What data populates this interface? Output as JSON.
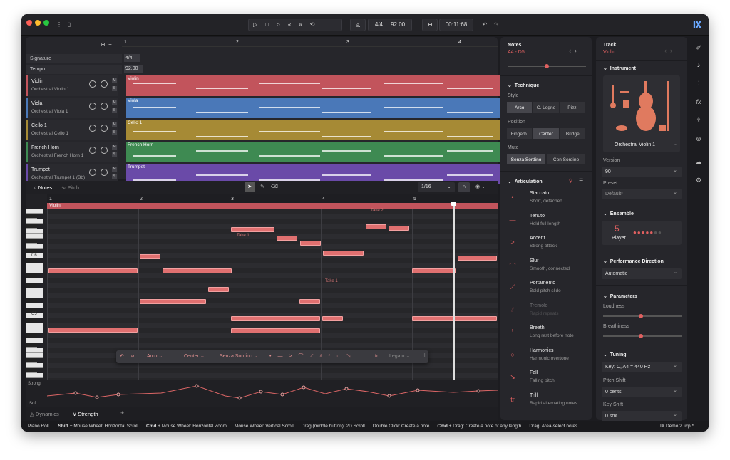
{
  "transport": {
    "signature": "4/4",
    "tempo": "92.00",
    "time": "00:11:68"
  },
  "arrange": {
    "bars": [
      "1",
      "2",
      "3",
      "4"
    ],
    "signature_label": "Signature",
    "signature_value": "4/4",
    "tempo_label": "Tempo",
    "tempo_value": "92.00",
    "tracks": [
      {
        "name": "Violin",
        "sub": "Orchestral Violin 1",
        "lane": "Violin",
        "color": "#c2545c"
      },
      {
        "name": "Viola",
        "sub": "Orchestral Viola 1",
        "lane": "Viola",
        "color": "#4a78b8"
      },
      {
        "name": "Cello 1",
        "sub": "Orchestral Cello 1",
        "lane": "Cello 1",
        "color": "#a68a35"
      },
      {
        "name": "French Horn",
        "sub": "Orchestral French Horn 1",
        "lane": "French Horn",
        "color": "#3e8a52"
      },
      {
        "name": "Trumpet",
        "sub": "Orchestral Trumpet 1 (Bb)",
        "lane": "Trumpet",
        "color": "#6a4aa8"
      }
    ],
    "m": "M",
    "s": "S"
  },
  "editor": {
    "tab_notes": "Notes",
    "tab_pitch": "Pitch",
    "grid": "1/16",
    "bars": [
      "1",
      "2",
      "3",
      "4",
      "5"
    ],
    "region": "Violin",
    "c6": "C6",
    "c5": "C5",
    "takes": [
      "Take 1",
      "Take 1",
      "Take 2"
    ],
    "bottom_tabs": {
      "dynamics": "Dynamics",
      "strength": "Strength"
    },
    "strong": "Strong",
    "soft": "Soft",
    "toolbar": {
      "style": "Arco",
      "position": "Center",
      "mute": "Senza Sordino",
      "legato": "Legato"
    }
  },
  "notes_panel": {
    "title": "Notes",
    "range": "A4 - D5",
    "technique": "Technique",
    "style": "Style",
    "styles": [
      "Arco",
      "C. Legno",
      "Pizz."
    ],
    "position": "Position",
    "positions": [
      "Fingerb.",
      "Center",
      "Bridge"
    ],
    "mute": "Mute",
    "mutes": [
      "Senza Sordino",
      "Con Sordino"
    ],
    "articulation": "Articulation",
    "articulations": [
      {
        "t": "Staccato",
        "d": "Short, detached",
        "i": "•"
      },
      {
        "t": "Tenuto",
        "d": "Held full length",
        "i": "—"
      },
      {
        "t": "Accent",
        "d": "Strong attack",
        "i": ">"
      },
      {
        "t": "Slur",
        "d": "Smooth, connected",
        "i": "⌒"
      },
      {
        "t": "Portamento",
        "d": "Bold pitch slide",
        "i": "⟋"
      },
      {
        "t": "Tremolo",
        "d": "Rapid repeats",
        "i": "⫽"
      },
      {
        "t": "Breath",
        "d": "Long rest before note",
        "i": "❜"
      },
      {
        "t": "Harmonics",
        "d": "Harmonic overtone",
        "i": "○"
      },
      {
        "t": "Fall",
        "d": "Falling pitch",
        "i": "↘"
      },
      {
        "t": "Trill",
        "d": "Rapid alternating notes",
        "i": "tr"
      }
    ]
  },
  "track_panel": {
    "title": "Track",
    "name": "Violin",
    "instrument": "Instrument",
    "preset_name": "Orchestral Violin 1",
    "version": "Version",
    "version_value": "90",
    "preset": "Preset",
    "preset_value": "Default*",
    "ensemble": "Ensemble",
    "players": "5",
    "player_label": "Player",
    "perf": "Performance Direction",
    "perf_value": "Automatic",
    "parameters": "Parameters",
    "loudness": "Loudness",
    "breathiness": "Breathiness",
    "tuning": "Tuning",
    "key": "Key: C, A4 = 440 Hz",
    "pitch_shift": "Pitch Shift",
    "pitch_value": "0 cents",
    "key_shift": "Key Shift",
    "key_value": "0 smt."
  },
  "status": {
    "mode": "Piano Roll",
    "hints": [
      {
        "k": "Shift",
        "v": " + Mouse Wheel: Horizontal Scroll"
      },
      {
        "k": "Cmd",
        "v": " + Mouse Wheel: Horizontal Zoom"
      },
      {
        "k": "",
        "v": "Mouse Wheel: Vertical Scroll"
      },
      {
        "k": "",
        "v": "Drag (middle button): 2D Scroll"
      },
      {
        "k": "",
        "v": "Double Click: Create a note"
      },
      {
        "k": "Cmd",
        "v": " + Drag: Create a note of any length"
      },
      {
        "k": "",
        "v": "Drag: Area-select notes"
      }
    ],
    "project": "IX Demo 2 .ixp *"
  }
}
